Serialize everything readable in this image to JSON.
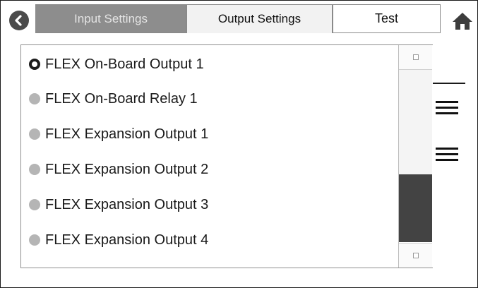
{
  "tabs": [
    {
      "label": "Input Settings",
      "state": "inactive"
    },
    {
      "label": "Output Settings",
      "state": "active"
    },
    {
      "label": "Test",
      "state": "normal"
    }
  ],
  "icons": {
    "back": "back-arrow-icon",
    "home": "home-icon",
    "menu": "hamburger-menu-icon"
  },
  "outputs": {
    "items": [
      {
        "label": "FLEX On-Board Output 1",
        "selected": true
      },
      {
        "label": "FLEX On-Board Relay 1",
        "selected": false
      },
      {
        "label": "FLEX Expansion Output 1",
        "selected": false
      },
      {
        "label": "FLEX Expansion Output 2",
        "selected": false
      },
      {
        "label": "FLEX Expansion Output 3",
        "selected": false
      },
      {
        "label": "FLEX Expansion Output 4",
        "selected": false
      }
    ],
    "scroll": {
      "thumb_start_fraction": 0.75,
      "thumb_end_fraction": 1.0
    }
  },
  "colors": {
    "selected_radio": "#1c1c1c",
    "unselected_radio": "#b5b5b5",
    "scroll_thumb": "#434343",
    "inactive_tab": "#8d8d8d"
  }
}
